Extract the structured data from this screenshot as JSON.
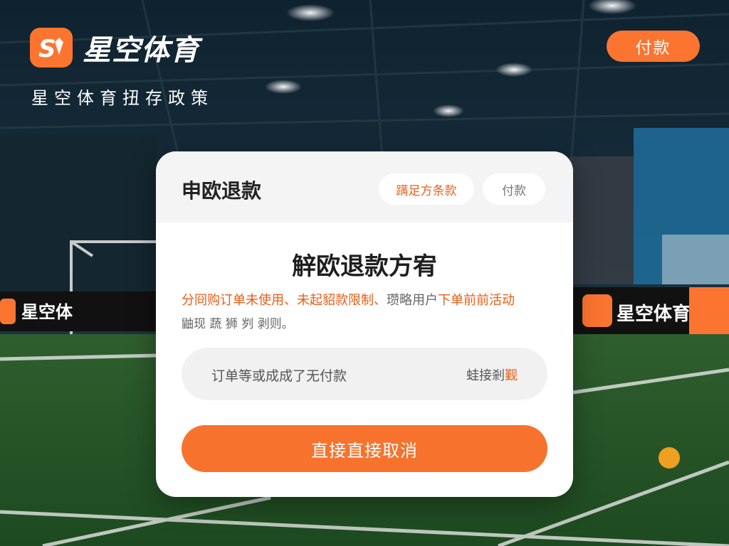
{
  "header": {
    "brand_name": "星空体育",
    "logo_letter": "S",
    "subtitle": "星空体育扭存政策",
    "pay_button_label": "付款"
  },
  "card": {
    "title": "申欧退款",
    "tabs": [
      {
        "label": "蹒足方条款"
      },
      {
        "label": "付款"
      }
    ],
    "plan_title": "觪欧退款方宥",
    "description": {
      "line1_part1": "分冏购订单未使用、未起貂款限制、",
      "line1_part2": "瓒略用户",
      "line1_part3": "下单前前活动",
      "line2": "鼬现 蔬 狮 刿 剥则。"
    },
    "status": {
      "text": "订单等或成成了无付款",
      "link_prefix": "蛙接剎",
      "link_suffix": "觐"
    },
    "cancel_button_label": "直接直接取消"
  },
  "background": {
    "banners": [
      "星空体育",
      "星空体育"
    ]
  },
  "colors": {
    "accent": "#fb7530",
    "accent_text": "#e85d18"
  }
}
